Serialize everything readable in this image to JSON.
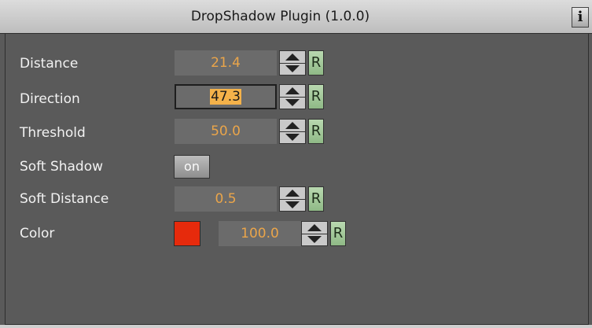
{
  "header": {
    "title": "DropShadow Plugin (1.0.0)",
    "info_label": "i"
  },
  "params": {
    "distance": {
      "label": "Distance",
      "value": "21.4"
    },
    "direction": {
      "label": "Direction",
      "value": "47.3"
    },
    "threshold": {
      "label": "Threshold",
      "value": "50.0"
    },
    "soft_shadow": {
      "label": "Soft Shadow",
      "toggle": "on"
    },
    "soft_distance": {
      "label": "Soft Distance",
      "value": "0.5"
    },
    "color": {
      "label": "Color",
      "value": "100.0",
      "swatch": "#e62a0c"
    }
  },
  "reset_label": "R",
  "icons": {
    "spin_up": "arrow-up-icon",
    "spin_down": "arrow-down-icon",
    "info": "info-icon"
  },
  "colors": {
    "panel_bg": "#5a5a5a",
    "field_bg": "#6b6b6b",
    "value_text": "#eaa54a",
    "selection": "#f4b24a",
    "reset_button": "#a7cc9d"
  }
}
